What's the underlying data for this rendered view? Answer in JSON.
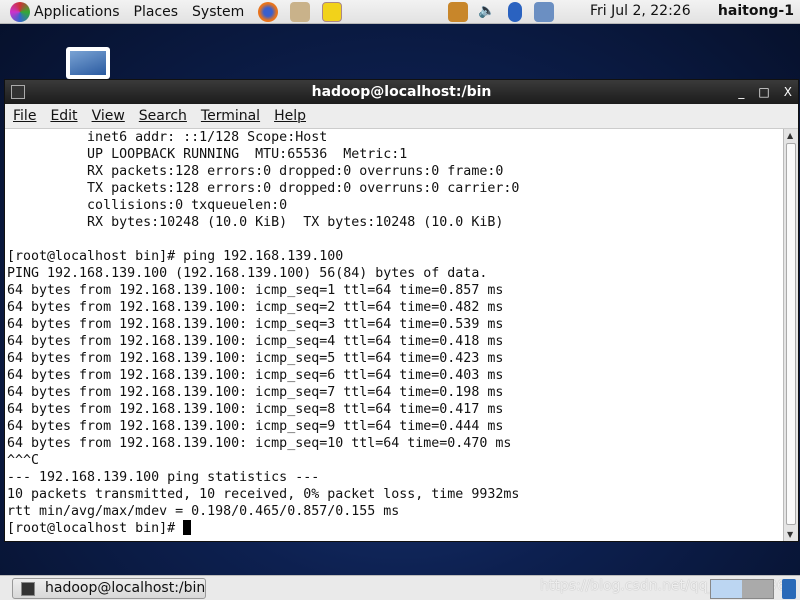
{
  "top_panel": {
    "menus": [
      "Applications",
      "Places",
      "System"
    ],
    "clock": "Fri Jul  2, 22:26",
    "user": "haitong-1"
  },
  "window": {
    "title": "hadoop@localhost:/bin",
    "menu": [
      "File",
      "Edit",
      "View",
      "Search",
      "Terminal",
      "Help"
    ]
  },
  "terminal": {
    "lines": [
      "          inet6 addr: ::1/128 Scope:Host",
      "          UP LOOPBACK RUNNING  MTU:65536  Metric:1",
      "          RX packets:128 errors:0 dropped:0 overruns:0 frame:0",
      "          TX packets:128 errors:0 dropped:0 overruns:0 carrier:0",
      "          collisions:0 txqueuelen:0",
      "          RX bytes:10248 (10.0 KiB)  TX bytes:10248 (10.0 KiB)",
      "",
      "[root@localhost bin]# ping 192.168.139.100",
      "PING 192.168.139.100 (192.168.139.100) 56(84) bytes of data.",
      "64 bytes from 192.168.139.100: icmp_seq=1 ttl=64 time=0.857 ms",
      "64 bytes from 192.168.139.100: icmp_seq=2 ttl=64 time=0.482 ms",
      "64 bytes from 192.168.139.100: icmp_seq=3 ttl=64 time=0.539 ms",
      "64 bytes from 192.168.139.100: icmp_seq=4 ttl=64 time=0.418 ms",
      "64 bytes from 192.168.139.100: icmp_seq=5 ttl=64 time=0.423 ms",
      "64 bytes from 192.168.139.100: icmp_seq=6 ttl=64 time=0.403 ms",
      "64 bytes from 192.168.139.100: icmp_seq=7 ttl=64 time=0.198 ms",
      "64 bytes from 192.168.139.100: icmp_seq=8 ttl=64 time=0.417 ms",
      "64 bytes from 192.168.139.100: icmp_seq=9 ttl=64 time=0.444 ms",
      "64 bytes from 192.168.139.100: icmp_seq=10 ttl=64 time=0.470 ms",
      "^^^C",
      "--- 192.168.139.100 ping statistics ---",
      "10 packets transmitted, 10 received, 0% packet loss, time 9932ms",
      "rtt min/avg/max/mdev = 0.198/0.465/0.857/0.155 ms"
    ],
    "prompt": "[root@localhost bin]# "
  },
  "taskbar": {
    "task": "hadoop@localhost:/bin",
    "watermark": "https://blog.csdn.net/qq_41863996"
  }
}
